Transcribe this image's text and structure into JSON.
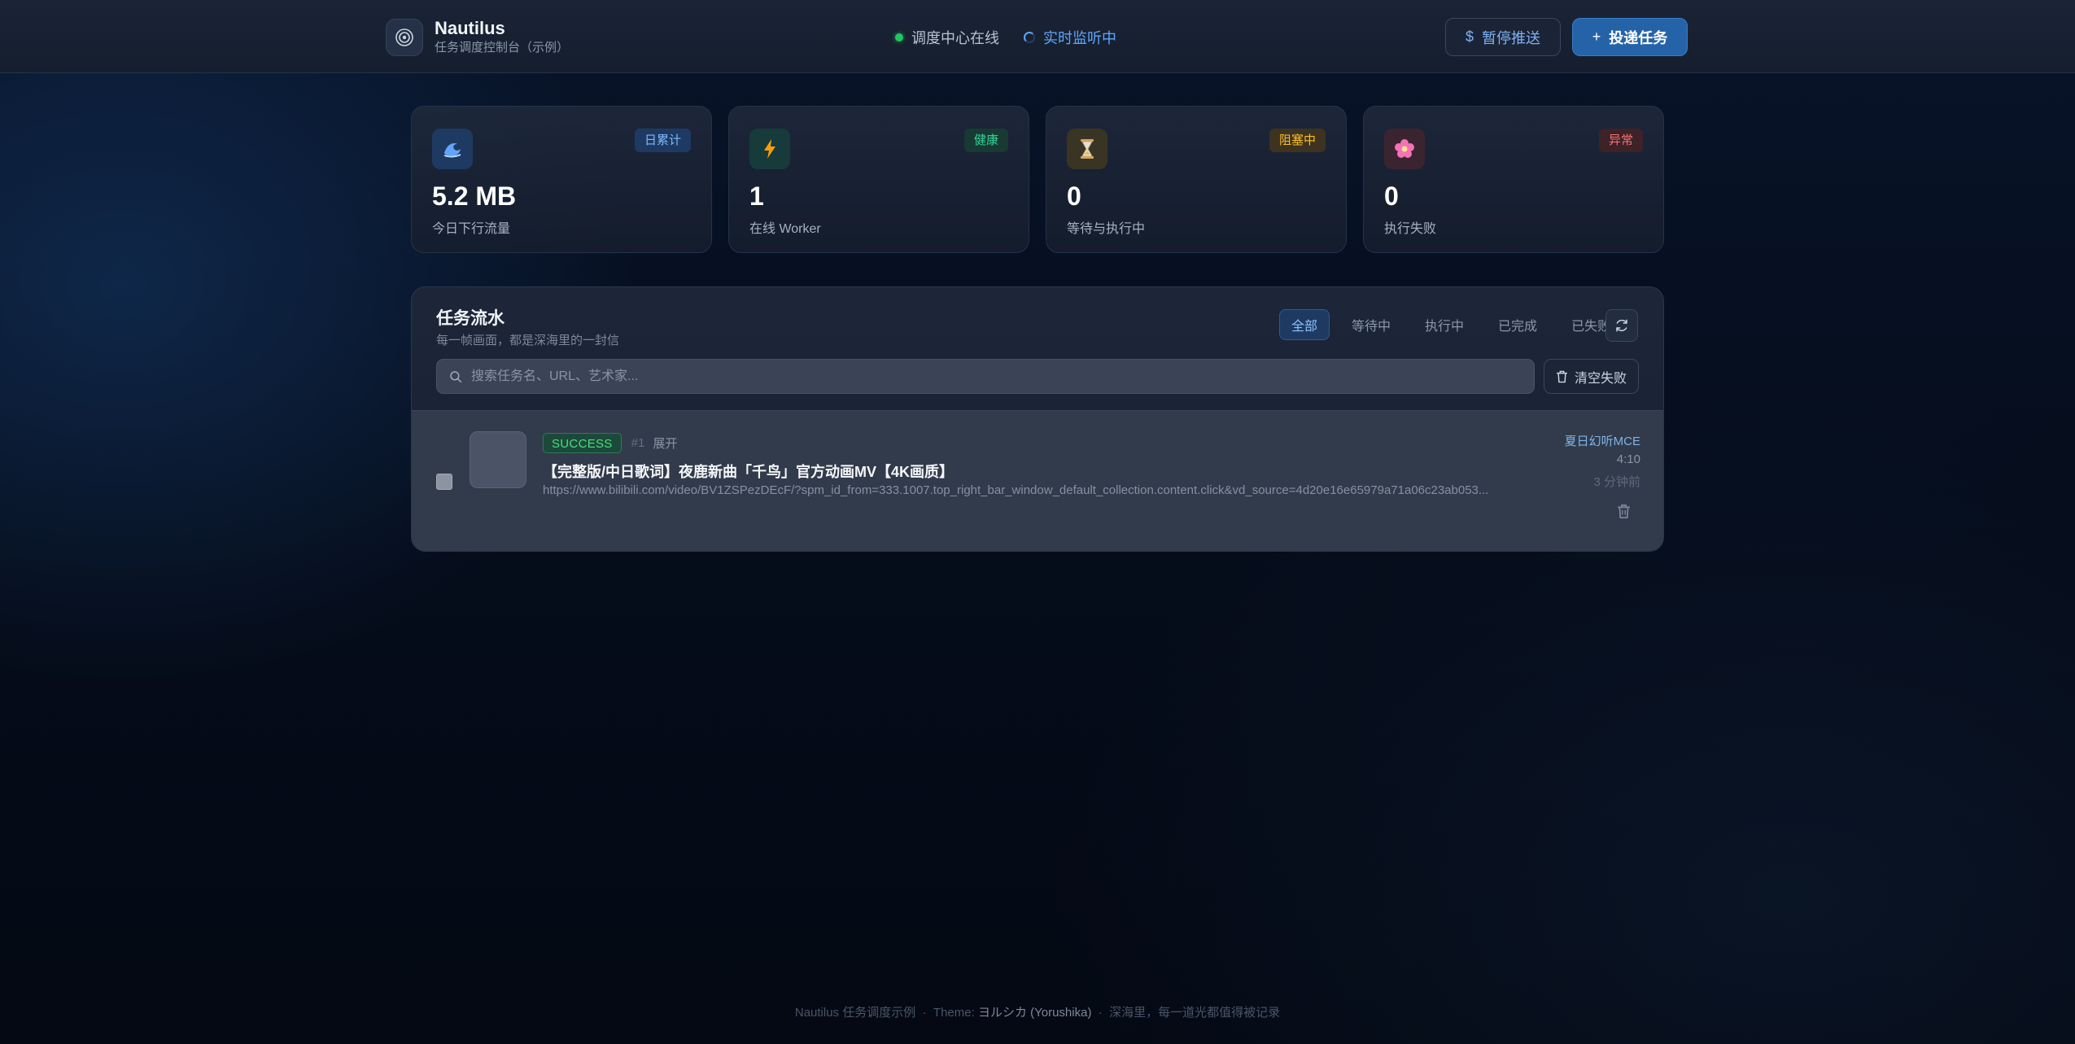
{
  "header": {
    "app_name": "Nautilus",
    "app_subtitle": "任务调度控制台（示例）",
    "status_online": "调度中心在线",
    "status_live": "实时监听中",
    "pause_label": "暂停推送",
    "submit_label": "投递任务"
  },
  "stats": [
    {
      "icon": "wave-icon",
      "badge": "日累计",
      "value": "5.2 MB",
      "label": "今日下行流量",
      "accent": "#60a5fa"
    },
    {
      "icon": "lightning-icon",
      "badge": "健康",
      "value": "1",
      "label": "在线 Worker",
      "accent": "#34d399"
    },
    {
      "icon": "hourglass-icon",
      "badge": "阻塞中",
      "value": "0",
      "label": "等待与执行中",
      "accent": "#fbbf24"
    },
    {
      "icon": "flower-icon",
      "badge": "异常",
      "value": "0",
      "label": "执行失败",
      "accent": "#f87171"
    }
  ],
  "tasks_panel": {
    "title": "任务流水",
    "subtitle": "每一帧画面，都是深海里的一封信",
    "filters": [
      "全部",
      "等待中",
      "执行中",
      "已完成",
      "已失败"
    ],
    "active_filter": "全部",
    "search_placeholder": "搜索任务名、URL、艺术家...",
    "clear_failed_label": "清空失败"
  },
  "tasks": [
    {
      "status": "SUCCESS",
      "id": "#1",
      "expand": "展开",
      "title": "【完整版/中日歌词】夜鹿新曲「千鸟」官方动画MV【4K画质】",
      "url": "https://www.bilibili.com/video/BV1ZSPezDEcF/?spm_id_from=333.1007.top_right_bar_window_default_collection.content.click&vd_source=4d20e16e65979a71a06c23ab053...",
      "artist": "夏日幻听MCE",
      "duration": "4:10",
      "time_ago": "3 分钟前"
    }
  ],
  "footer": {
    "prefix": "Nautilus 任务调度示例",
    "sep1": "·",
    "theme_label": "Theme:",
    "theme_name": "ヨルシカ (Yorushika)",
    "sep2": "·",
    "motto": "深海里，每一道光都值得被记录"
  },
  "colors": {
    "accent": "#2563a8",
    "success": "#4ade80",
    "background": "#050c1a"
  }
}
